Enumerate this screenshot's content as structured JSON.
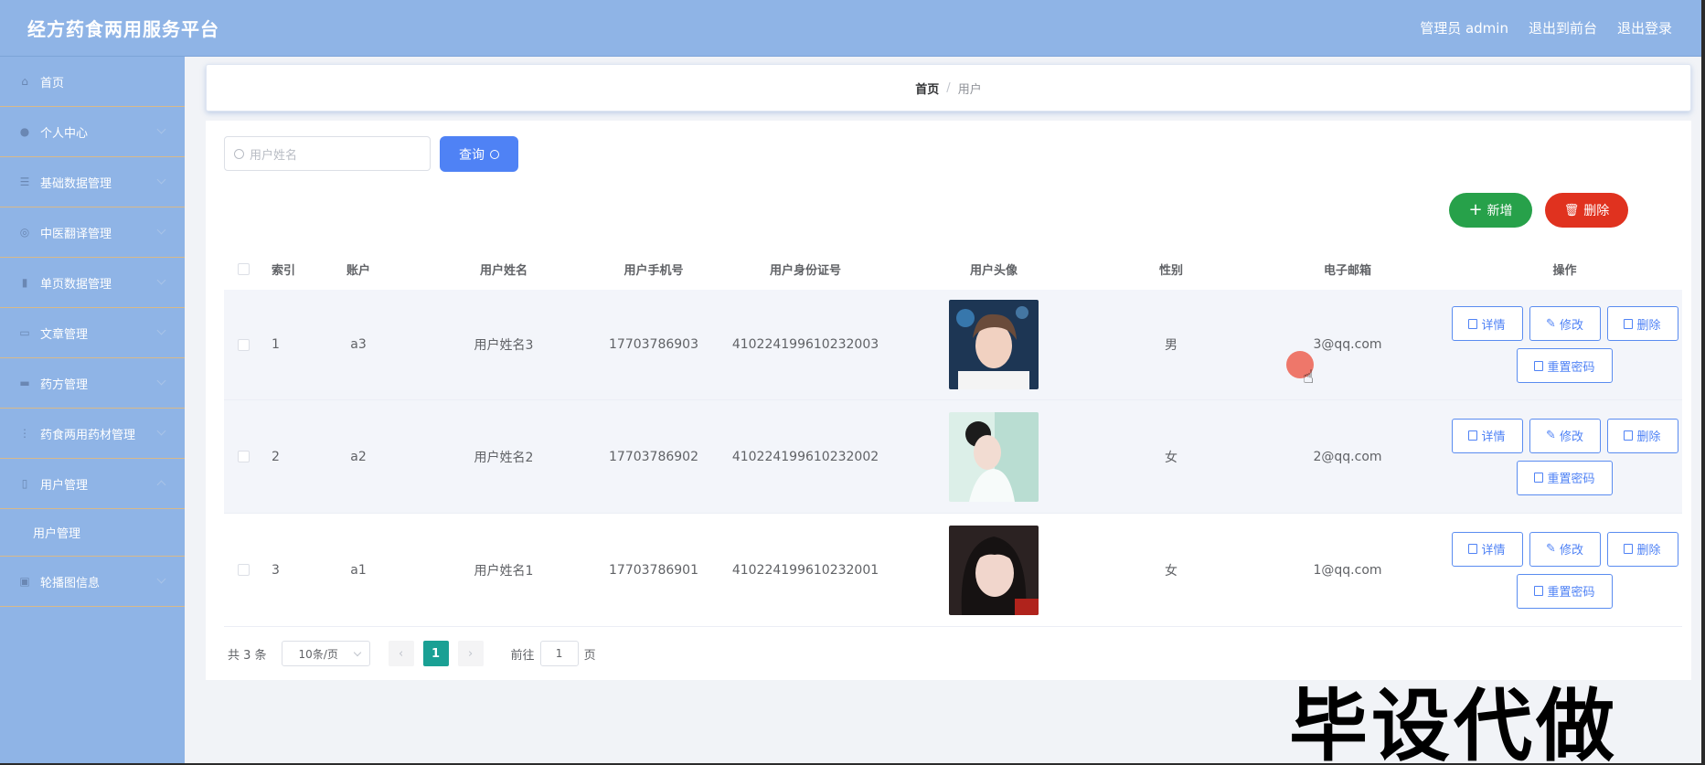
{
  "header": {
    "title": "经方药食两用服务平台",
    "admin_label": "管理员 admin",
    "exit_front": "退出到前台",
    "logout": "退出登录"
  },
  "sidebar": {
    "items": [
      {
        "label": "首页",
        "icon": "home-icon"
      },
      {
        "label": "个人中心",
        "icon": "user-icon"
      },
      {
        "label": "基础数据管理",
        "icon": "list-icon"
      },
      {
        "label": "中医翻译管理",
        "icon": "globe-icon"
      },
      {
        "label": "单页数据管理",
        "icon": "chart-icon"
      },
      {
        "label": "文章管理",
        "icon": "doc-icon"
      },
      {
        "label": "药方管理",
        "icon": "book-icon"
      },
      {
        "label": "药食两用药材管理",
        "icon": "herb-icon"
      },
      {
        "label": "用户管理",
        "icon": "phone-icon"
      },
      {
        "label": "用户管理",
        "icon": ""
      },
      {
        "label": "轮播图信息",
        "icon": "image-icon"
      }
    ]
  },
  "breadcrumb": {
    "home": "首页",
    "separator": "/",
    "current": "用户"
  },
  "search": {
    "placeholder": "用户姓名",
    "query_label": "查询"
  },
  "actions": {
    "add_label": "新增",
    "delete_label": "删除"
  },
  "table": {
    "headers": [
      "索引",
      "账户",
      "用户姓名",
      "用户手机号",
      "用户身份证号",
      "用户头像",
      "性别",
      "电子邮箱",
      "操作"
    ],
    "rows": [
      {
        "index": "1",
        "account": "a3",
        "name": "用户姓名3",
        "phone": "17703786903",
        "id_card": "410224199610232003",
        "sex": "男",
        "email": "3@qq.com"
      },
      {
        "index": "2",
        "account": "a2",
        "name": "用户姓名2",
        "phone": "17703786902",
        "id_card": "410224199610232002",
        "sex": "女",
        "email": "2@qq.com"
      },
      {
        "index": "3",
        "account": "a1",
        "name": "用户姓名1",
        "phone": "17703786901",
        "id_card": "410224199610232001",
        "sex": "女",
        "email": "1@qq.com"
      }
    ],
    "ops": {
      "detail": "详情",
      "edit": "修改",
      "delete": "删除",
      "reset_password": "重置密码"
    }
  },
  "pagination": {
    "total": "共 3 条",
    "page_size": "10条/页",
    "current_page": "1",
    "goto_label": "前往",
    "goto_value": "1",
    "page_suffix": "页"
  },
  "watermark": "毕设代做",
  "colors": {
    "header": "#8fb4e6",
    "primary": "#4f82f5",
    "success": "#27a14a",
    "danger": "#e0321f",
    "page_active": "#1aa094"
  }
}
